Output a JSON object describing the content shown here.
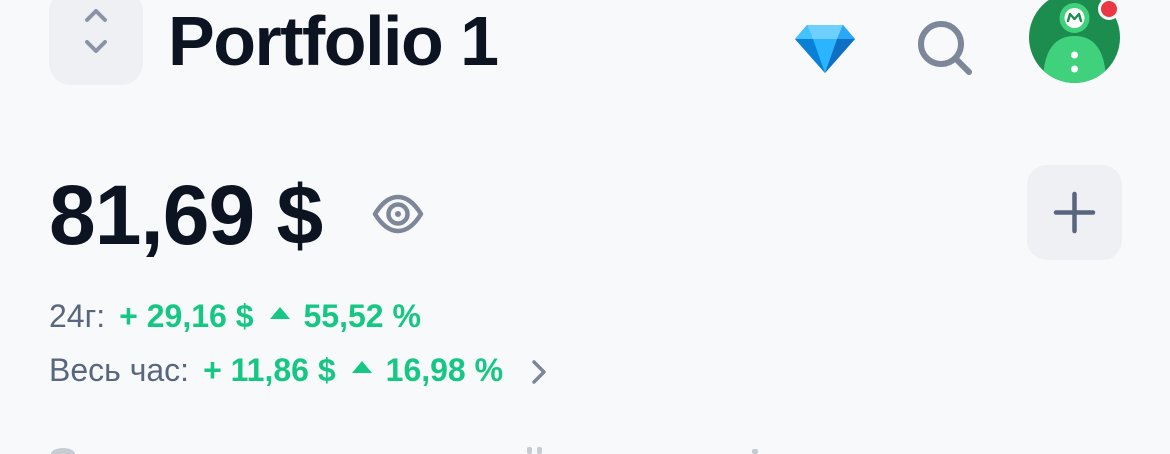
{
  "header": {
    "portfolio_title": "Portfolio 1",
    "icons": [
      "chevron-up-down-icon",
      "diamond-icon",
      "search-icon",
      "avatar"
    ]
  },
  "summary": {
    "balance": "81,69 $",
    "change_24h": {
      "label": "24г:",
      "abs": "+ 29,16 $",
      "pct": "55,52 %"
    },
    "change_all": {
      "label": "Весь час:",
      "abs": "+ 11,86 $",
      "pct": "16,98 %"
    }
  },
  "colors": {
    "background": "#f8f9fb",
    "text_primary": "#0d1421",
    "text_secondary": "#58667e",
    "positive": "#16c784",
    "button_bg": "#eef0f4",
    "avatar_green": "#1f9a5a",
    "notify_red": "#ea3943"
  }
}
